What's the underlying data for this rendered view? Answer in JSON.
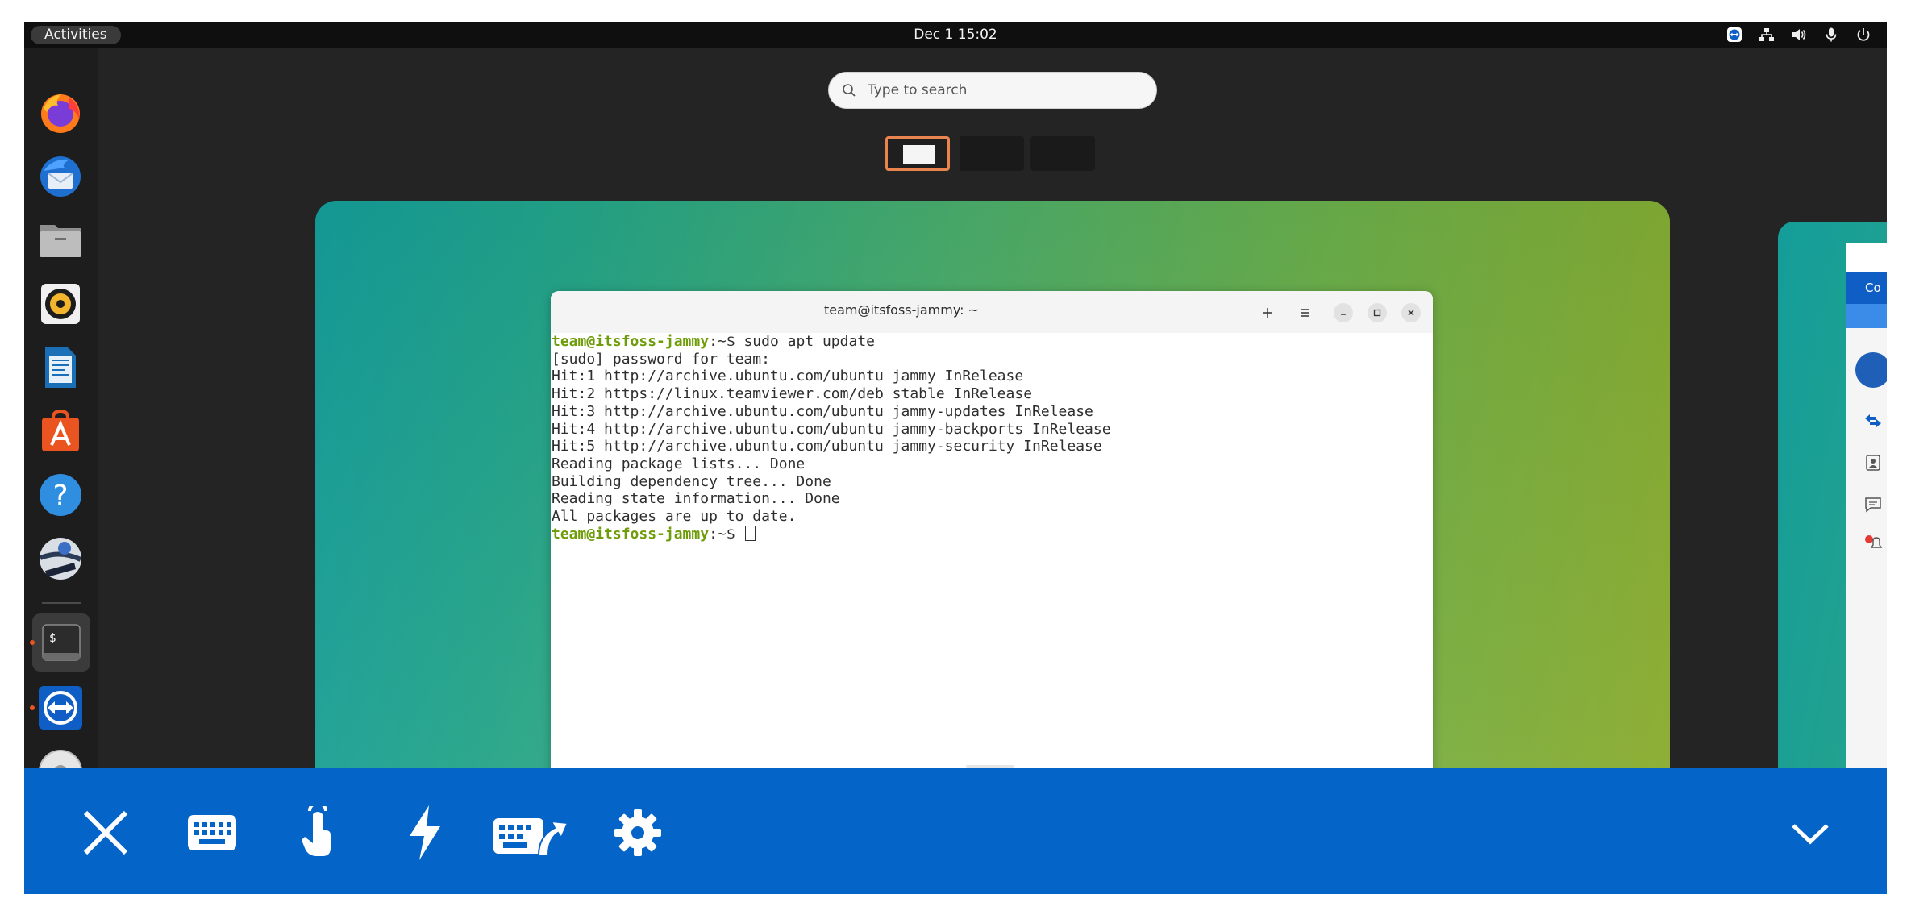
{
  "topbar": {
    "activities_label": "Activities",
    "clock": "Dec 1  15:02",
    "tray_icons": [
      "teamviewer-icon",
      "network-icon",
      "volume-icon",
      "microphone-icon",
      "power-icon"
    ]
  },
  "dock": {
    "apps": [
      {
        "name": "Firefox",
        "icon": "firefox-icon",
        "running": false
      },
      {
        "name": "Thunderbird",
        "icon": "thunderbird-icon",
        "running": false
      },
      {
        "name": "Files",
        "icon": "files-icon",
        "running": false
      },
      {
        "name": "Rhythmbox",
        "icon": "rhythmbox-icon",
        "running": false
      },
      {
        "name": "LibreOffice Writer",
        "icon": "writer-icon",
        "running": false
      },
      {
        "name": "Ubuntu Software",
        "icon": "software-icon",
        "running": false
      },
      {
        "name": "Help",
        "icon": "help-icon",
        "running": false
      },
      {
        "name": "OpenShot",
        "icon": "openshot-icon",
        "running": false
      },
      {
        "name": "Terminal",
        "icon": "terminal-icon",
        "running": true
      },
      {
        "name": "TeamViewer",
        "icon": "teamviewer-icon",
        "running": true
      },
      {
        "name": "Disc",
        "icon": "disc-icon",
        "running": false
      }
    ]
  },
  "search": {
    "placeholder": "Type to search"
  },
  "workspaces": {
    "count": 3,
    "active": 1
  },
  "terminal": {
    "title": "team@itsfoss-jammy: ~",
    "prompt_user": "team@itsfoss-jammy",
    "prompt_path": ":~$ ",
    "command": "sudo apt update",
    "output": [
      "[sudo] password for team:",
      "Hit:1 http://archive.ubuntu.com/ubuntu jammy InRelease",
      "Hit:2 https://linux.teamviewer.com/deb stable InRelease",
      "Hit:3 http://archive.ubuntu.com/ubuntu jammy-updates InRelease",
      "Hit:4 http://archive.ubuntu.com/ubuntu jammy-backports InRelease",
      "Hit:5 http://archive.ubuntu.com/ubuntu jammy-security InRelease",
      "Reading package lists... Done",
      "Building dependency tree... Done",
      "Reading state information... Done",
      "All packages are up to date."
    ],
    "buttons": [
      "new-tab",
      "menu",
      "minimize",
      "maximize",
      "close"
    ]
  },
  "teamviewer_peek": {
    "banner_text": "Co"
  },
  "toolbar": {
    "buttons": [
      "close-session",
      "keyboard",
      "touch",
      "actions",
      "send-keys",
      "settings"
    ],
    "collapse": "chevron-down"
  },
  "colors": {
    "prompt_green": "#6f9d0a",
    "toolbar_blue": "#0564c8",
    "accent_orange": "#e9844e"
  }
}
